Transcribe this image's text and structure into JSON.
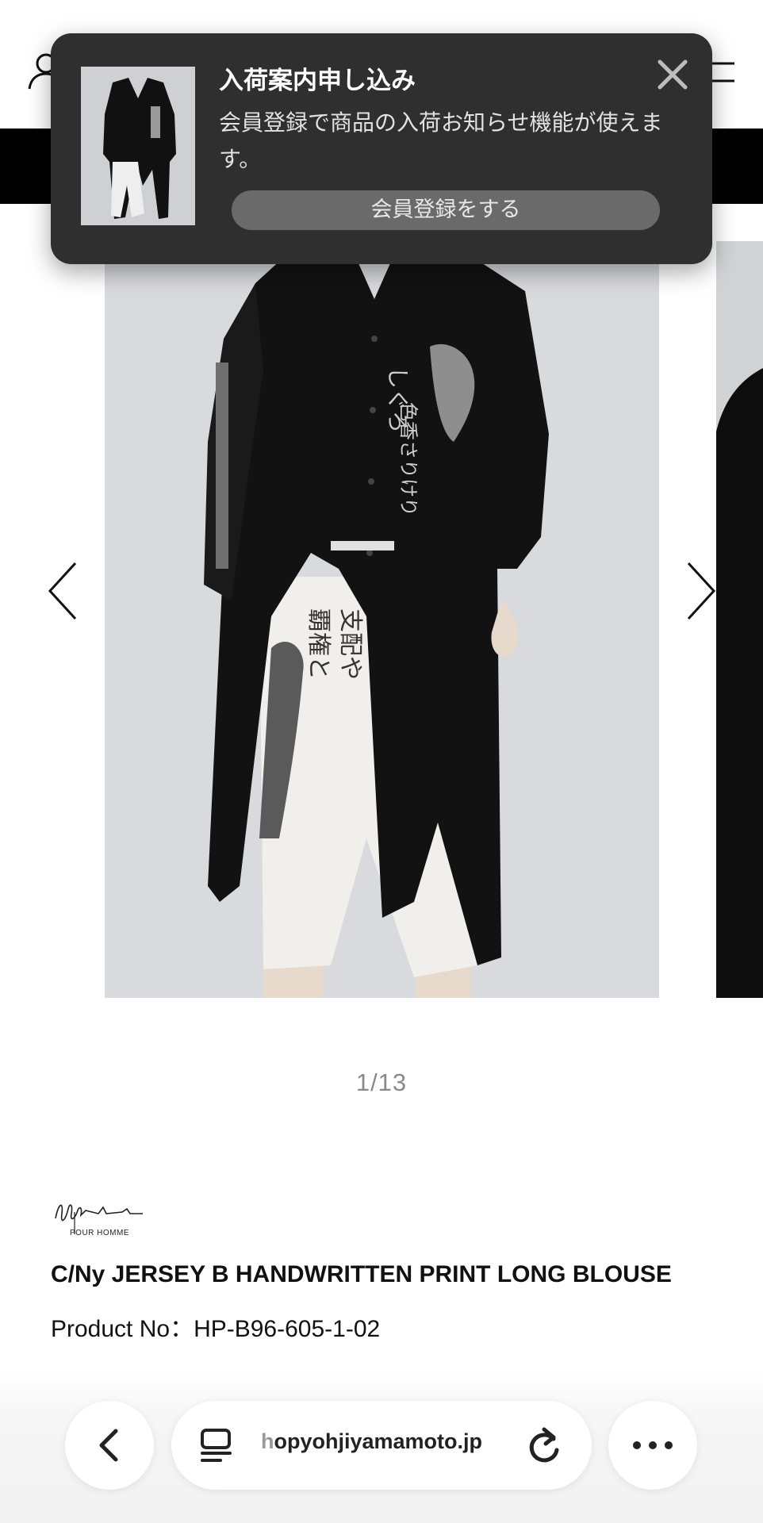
{
  "notification": {
    "title": "入荷案内申し込み",
    "body": "会員登録で商品の入荷お知らせ機能が使えます。",
    "cta_label": "会員登録をする",
    "close_icon": "close-icon",
    "thumbnail": "product-thumbnail"
  },
  "gallery": {
    "counter": "1/13",
    "prev_icon": "chevron-left-icon",
    "next_icon": "chevron-right-icon",
    "image_text": {
      "chest_line_1": "しぐろ",
      "chest_line_2": "色香さりけり",
      "pants_line_1": "支配や",
      "pants_line_2": "覇権と"
    }
  },
  "product": {
    "brand_sub": "POUR HOMME",
    "name": "C/Ny JERSEY B HANDWRITTEN PRINT LONG BLOUSE",
    "number": "Product No：HP-B96-605-1-02"
  },
  "browser": {
    "url_prefix": "h",
    "url_rest": "opyohjiyamamoto.jp",
    "back_icon": "back-arrow-icon",
    "tabs_icon": "reader-icon",
    "reload_icon": "reload-icon",
    "more_icon": "more-icon"
  },
  "colors": {
    "popup_bg": "#2f2f30",
    "cta_bg": "#6a6a6b",
    "page_bg": "#ffffff",
    "counter": "#8a8a8a"
  }
}
